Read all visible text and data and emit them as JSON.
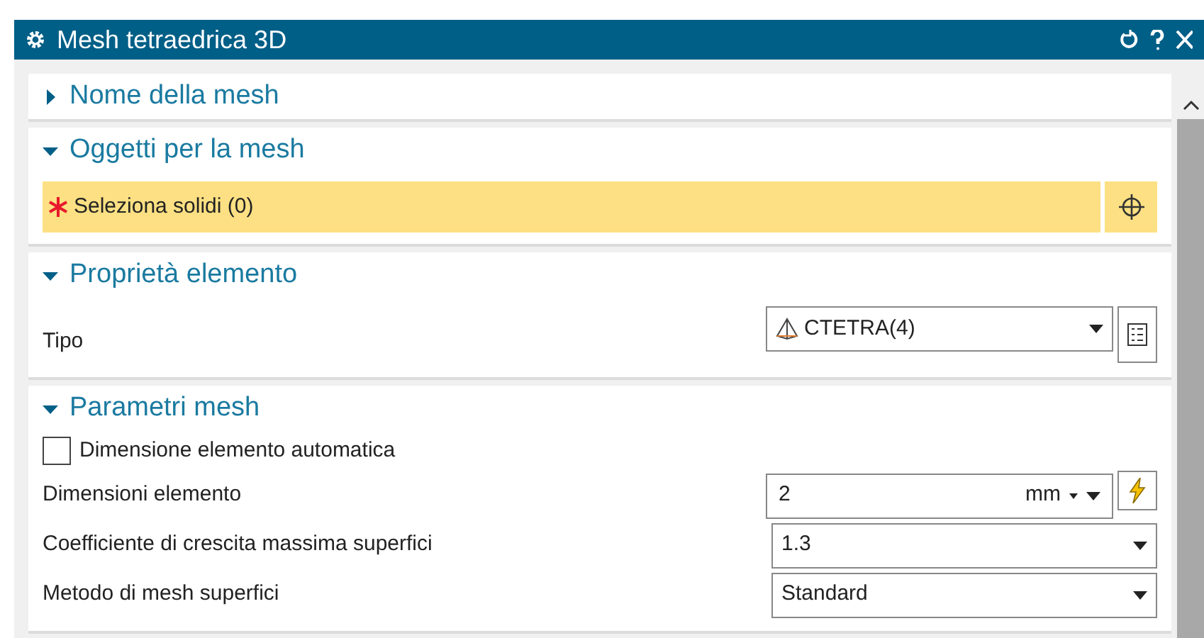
{
  "window": {
    "title": "Mesh tetraedrica 3D"
  },
  "sections": [
    {
      "title": "Nome della mesh",
      "expanded": false
    },
    {
      "title": "Oggetti per la mesh",
      "expanded": true,
      "rows": [
        {
          "kind": "select",
          "label": "Seleziona solidi (0)",
          "required": true
        }
      ]
    },
    {
      "title": "Proprietà elemento",
      "expanded": true,
      "rows": [
        {
          "kind": "typedrop",
          "label": "Tipo",
          "value": "CTETRA(4)"
        }
      ]
    },
    {
      "title": "Parametri mesh",
      "expanded": true,
      "rows": [
        {
          "kind": "checkbox",
          "label": "Dimensione elemento automatica",
          "checked": false
        },
        {
          "kind": "unit",
          "label": "Dimensioni elemento",
          "value": "2",
          "unit": "mm"
        },
        {
          "kind": "dropdown",
          "label": "Coefficiente di crescita massima superfici",
          "value": "1.3"
        },
        {
          "kind": "dropdown",
          "label": "Metodo di mesh superfici",
          "value": "Standard"
        }
      ]
    }
  ]
}
